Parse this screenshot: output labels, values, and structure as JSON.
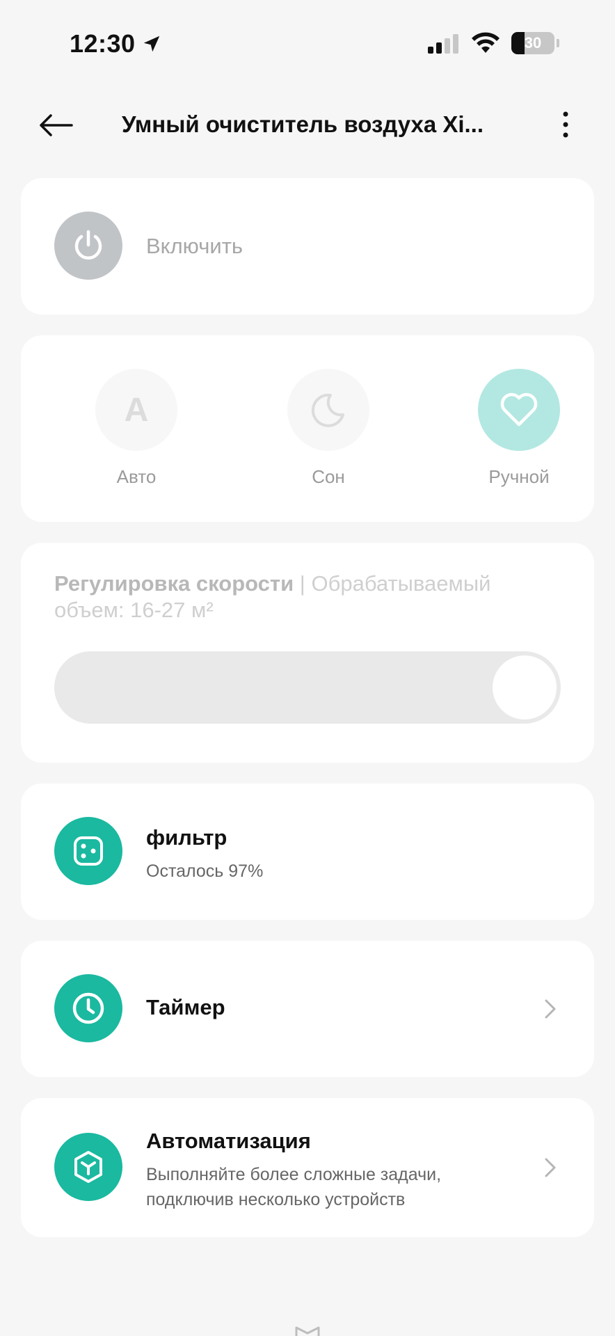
{
  "status": {
    "time": "12:30",
    "battery": "30",
    "battery_level": 0.3
  },
  "header": {
    "title": "Умный очиститель воздуха Xi..."
  },
  "power": {
    "label": "Включить"
  },
  "modes": [
    {
      "label": "Авто",
      "glyph": "A",
      "icon": "auto-a-icon",
      "active": false
    },
    {
      "label": "Сон",
      "icon": "moon-icon",
      "active": false
    },
    {
      "label": "Ручной",
      "icon": "heart-icon",
      "active": true
    }
  ],
  "speed": {
    "title": "Регулировка скорости",
    "separator": "|",
    "description": "Обрабатываемый объем: 16-27 м²",
    "level": 1.0
  },
  "filter": {
    "title": "фильтр",
    "subtitle": "Осталось 97%"
  },
  "timer": {
    "title": "Таймер"
  },
  "automation": {
    "title": "Автоматизация",
    "subtitle_line1": "Выполняйте более сложные задачи,",
    "subtitle_line2": "подключив несколько устройств"
  },
  "colors": {
    "accent": "#1ab9a0",
    "accent_light": "#b3e8e2",
    "power_off": "#c1c4c7",
    "background": "#f6f6f6"
  }
}
